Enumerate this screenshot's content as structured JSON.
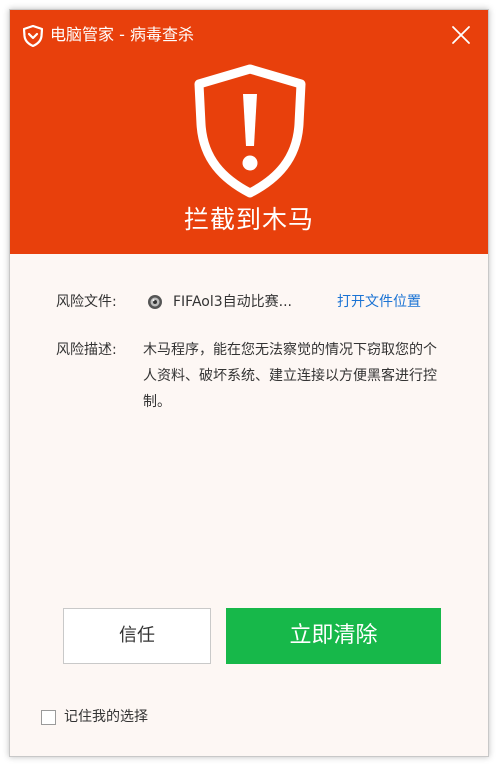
{
  "window": {
    "title": "电脑管家 - 病毒查杀"
  },
  "alert": {
    "headline": "拦截到木马"
  },
  "details": {
    "file_label": "风险文件:",
    "file_name": "FIFAol3自动比赛...",
    "open_location": "打开文件位置",
    "desc_label": "风险描述:",
    "description": "木马程序，能在您无法察觉的情况下窃取您的个人资料、破坏系统、建立连接以方便黑客进行控制。"
  },
  "actions": {
    "trust": "信任",
    "clean": "立即清除"
  },
  "footer": {
    "remember": "记住我的选择"
  },
  "colors": {
    "header": "#e8400c",
    "clean_button": "#17b84a",
    "link": "#1a73d4"
  },
  "icons": {
    "logo": "shield-logo-icon",
    "close": "close-icon",
    "alert": "shield-exclamation-icon",
    "file": "file-icon"
  }
}
